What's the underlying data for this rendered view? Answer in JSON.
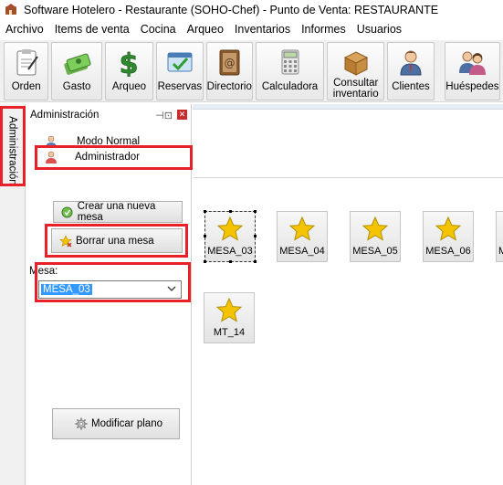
{
  "window": {
    "title": "Software Hotelero - Restaurante (SOHO-Chef)  - Punto de Venta: RESTAURANTE"
  },
  "menubar": [
    "Archivo",
    "Items de venta",
    "Cocina",
    "Arqueo",
    "Inventarios",
    "Informes",
    "Usuarios"
  ],
  "toolbar": {
    "orden": "Orden",
    "gasto": "Gasto",
    "arqueo": "Arqueo",
    "reservas": "Reservas",
    "directorio": "Directorio",
    "calculadora": "Calculadora",
    "inventario_l1": "Consultar",
    "inventario_l2": "inventario",
    "clientes": "Clientes",
    "huespedes": "Huéspedes"
  },
  "sidetab": {
    "label": "Administración"
  },
  "panel": {
    "title": "Administración",
    "modes": {
      "normal": "Modo Normal",
      "admin": "Administrador"
    },
    "create_table": "Crear una nueva mesa",
    "delete_table": "Borrar una mesa",
    "mesa_label": "Mesa:",
    "mesa_value": "MESA_03",
    "modify_plan": "Modificar plano"
  },
  "tables": [
    "MESA_03",
    "MESA_04",
    "MESA_05",
    "MESA_06",
    "M",
    "MT_14"
  ],
  "colors": {
    "highlight": "#e8202a",
    "selection": "#3399ff",
    "star": "#f5c400"
  }
}
